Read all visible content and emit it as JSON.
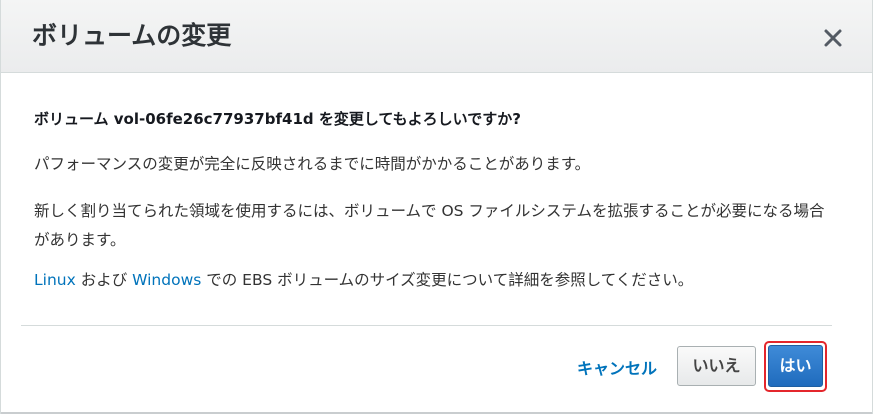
{
  "dialog": {
    "title": "ボリュームの変更",
    "close_icon": "close-icon",
    "question": "ボリューム vol-06fe26c77937bf41d を変更してもよろしいですか?",
    "paragraph1": "パフォーマンスの変更が完全に反映されるまでに時間がかかることがあります。",
    "paragraph2": "新しく割り当てられた領域を使用するには、ボリュームで OS ファイルシステムを拡張することが必要になる場合があります。",
    "paragraph3": {
      "link_linux": "Linux",
      "text_and": " および ",
      "link_windows": "Windows",
      "text_rest": " での EBS ボリュームのサイズ変更について詳細を参照してください。"
    },
    "buttons": {
      "cancel": "キャンセル",
      "no": "いいえ",
      "yes": "はい"
    }
  },
  "colors": {
    "link": "#0073bb",
    "primary_button": "#1f6bbd",
    "highlight_outline": "#e4262c",
    "header_bg": "#f0f1f1"
  }
}
